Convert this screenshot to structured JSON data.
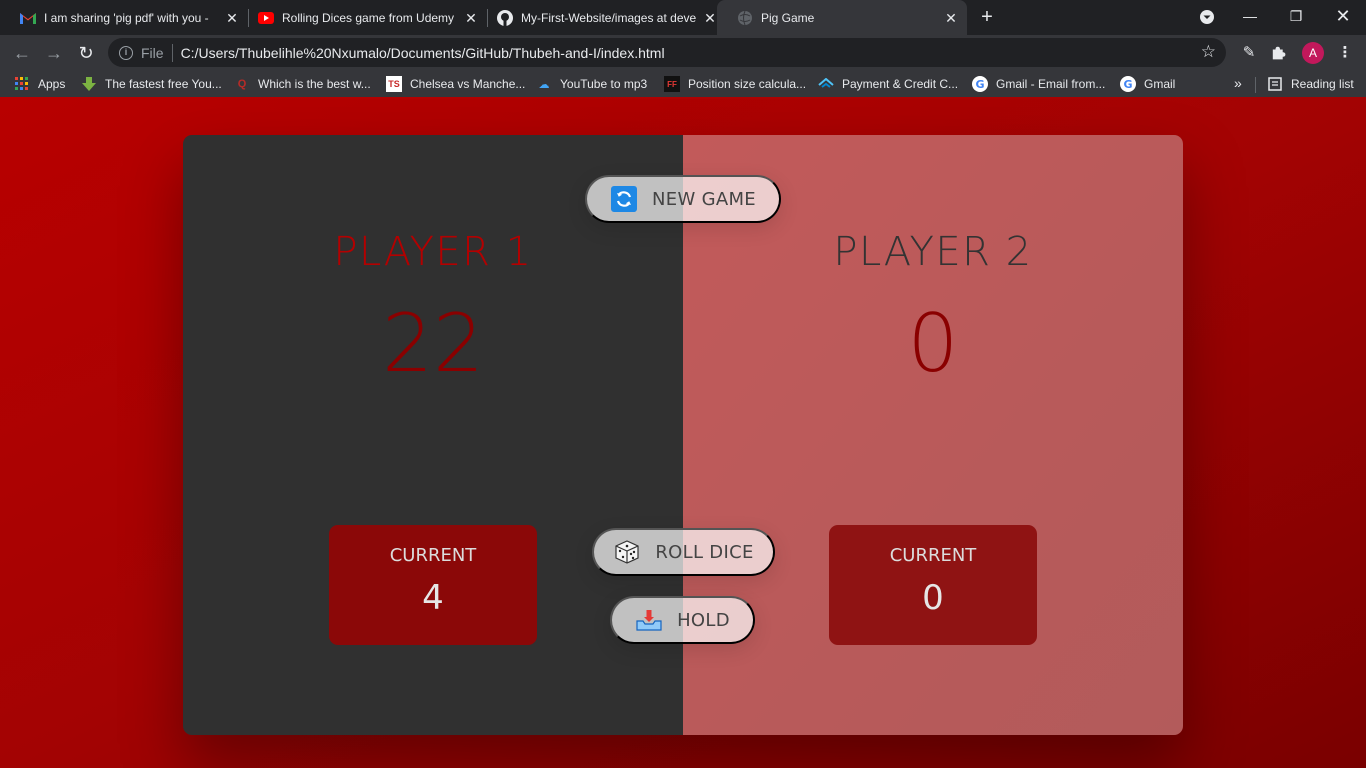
{
  "tabs": [
    {
      "title": "I am sharing 'pig pdf' with you - ",
      "icon": "gmail-icon"
    },
    {
      "title": "Rolling Dices game from Udemy",
      "icon": "youtube-icon"
    },
    {
      "title": "My-First-Website/images at deve",
      "icon": "github-icon"
    },
    {
      "title": "Pig Game",
      "icon": "globe-icon"
    }
  ],
  "toolbar": {
    "scheme": "File",
    "url": "C:/Users/Thubelihle%20Nxumalo/Documents/GitHub/Thubeh-and-I/index.html",
    "avatar_letter": "A"
  },
  "bookmarks": [
    {
      "label": "Apps",
      "icon": "apps-grid-icon"
    },
    {
      "label": "The fastest free You...",
      "icon": "download-arrow-icon"
    },
    {
      "label": "Which is the best w...",
      "icon": "quora-icon"
    },
    {
      "label": "Chelsea vs Manche...",
      "icon": "ts-icon"
    },
    {
      "label": "YouTube to mp3",
      "icon": "cloud-download-icon"
    },
    {
      "label": "Position size calcula...",
      "icon": "ff-icon"
    },
    {
      "label": "Payment & Credit C...",
      "icon": "payment-icon"
    },
    {
      "label": "Gmail - Email from...",
      "icon": "google-icon"
    },
    {
      "label": "Gmail",
      "icon": "google-icon"
    }
  ],
  "reading_list": "Reading list",
  "game": {
    "new_game": "NEW GAME",
    "roll_dice": "ROLL DICE",
    "hold": "HOLD",
    "players": [
      {
        "name": "Player 1",
        "score": "22",
        "current_label": "Current",
        "current": "4",
        "active": true
      },
      {
        "name": "Player 2",
        "score": "0",
        "current_label": "Current",
        "current": "0",
        "active": false
      }
    ]
  },
  "colors": {
    "background": "#b80000",
    "active_player_panel": "#303030",
    "inactive_player_panel": "#c25a5a",
    "active_name": "#b40000",
    "score": "#8a0000"
  }
}
